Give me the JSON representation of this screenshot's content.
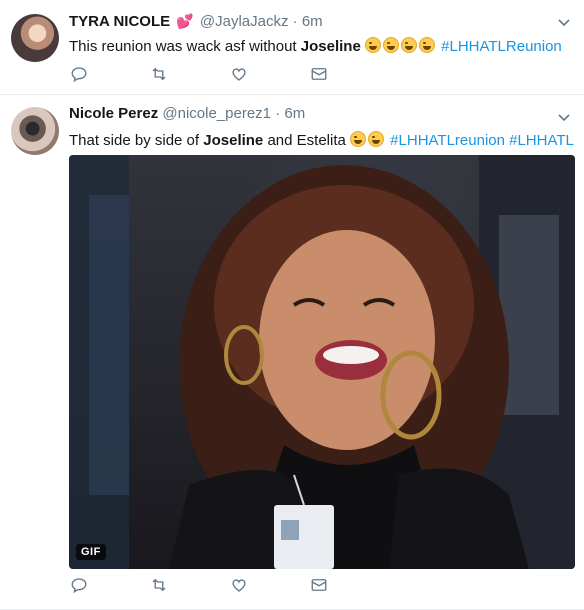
{
  "tweets": [
    {
      "name": "TYRA NICOLE",
      "name_emoji": "💕",
      "handle": "@JaylaJackz",
      "separator": "·",
      "time": "6m",
      "text_before": "This reunion was wack asf without ",
      "text_bold": "Joseline",
      "emoji_count": 4,
      "hashtags": "#LHHATLReunion"
    },
    {
      "name": "Nicole Perez",
      "handle": "@nicole_perez1",
      "separator": "·",
      "time": "6m",
      "text_before": "That side by side of ",
      "text_bold": "Joseline",
      "text_after": " and Estelita ",
      "emoji_count": 2,
      "hashtags": "#LHHATLreunion #LHHATL",
      "media_badge": "GIF"
    }
  ],
  "icons": [
    "reply-icon",
    "retweet-icon",
    "like-icon",
    "direct-message-icon",
    "chevron-down-icon"
  ],
  "colors": {
    "link": "#1b95e0",
    "secondary": "#657786",
    "border": "#e6ecf0"
  }
}
